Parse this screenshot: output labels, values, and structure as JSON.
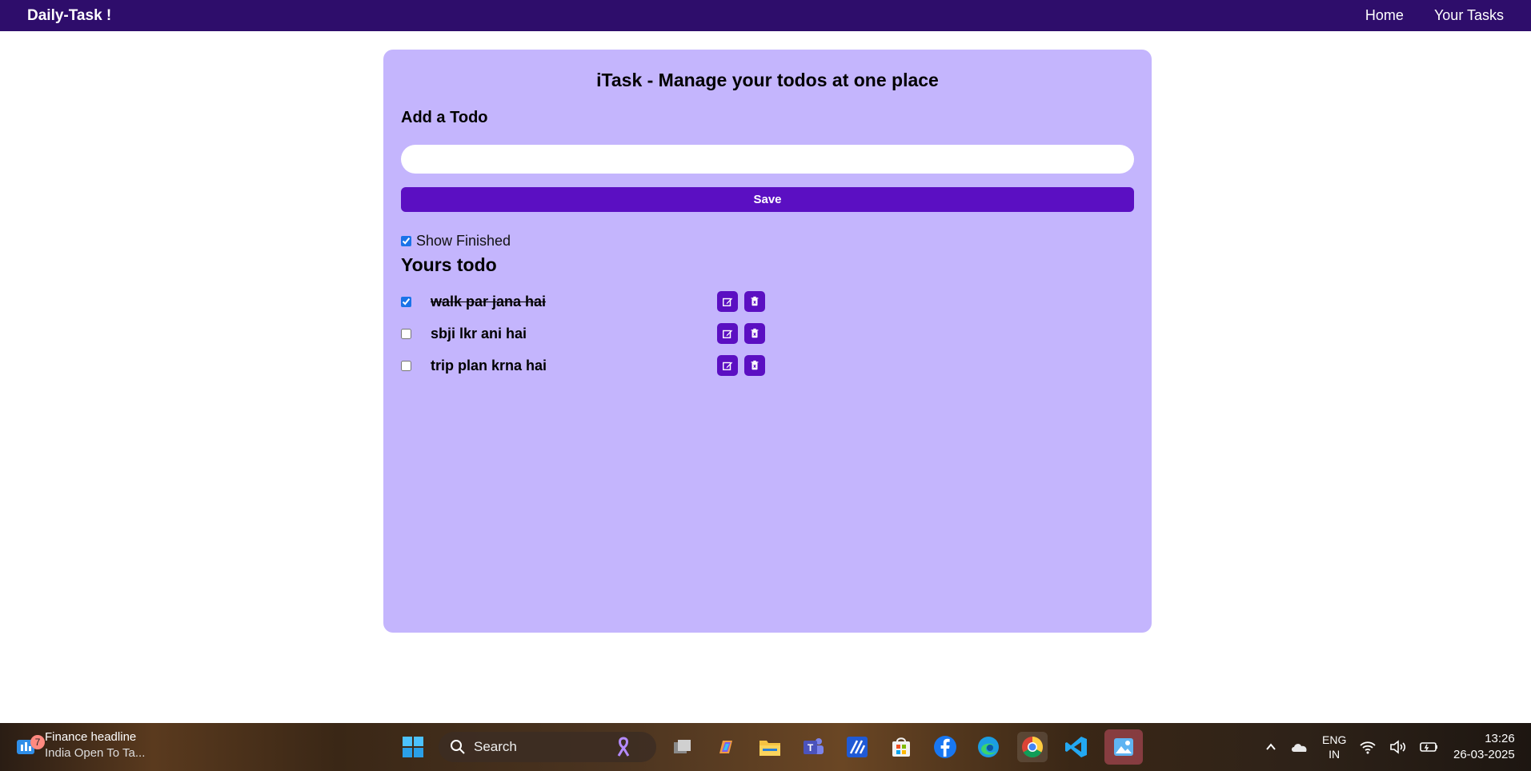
{
  "navbar": {
    "brand": "Daily-Task !",
    "links": [
      "Home",
      "Your Tasks"
    ]
  },
  "card": {
    "title": "iTask - Manage your todos at one place",
    "add_title": "Add a Todo",
    "input_value": "",
    "save_label": "Save",
    "show_finished_label": "Show Finished",
    "show_finished_checked": true,
    "list_title": "Yours todo"
  },
  "todos": [
    {
      "text": "walk par jana hai",
      "done": true
    },
    {
      "text": "sbji lkr ani hai",
      "done": false
    },
    {
      "text": "trip plan krna hai",
      "done": false
    }
  ],
  "taskbar": {
    "news_badge": "7",
    "news_title": "Finance headline",
    "news_sub": "India Open To Ta...",
    "search_label": "Search",
    "lang_line1": "ENG",
    "lang_line2": "IN",
    "time": "13:26",
    "date": "26-03-2025"
  },
  "colors": {
    "navbar": "#2e0d6b",
    "card": "#c4b5fd",
    "button": "#5b0fc2"
  }
}
